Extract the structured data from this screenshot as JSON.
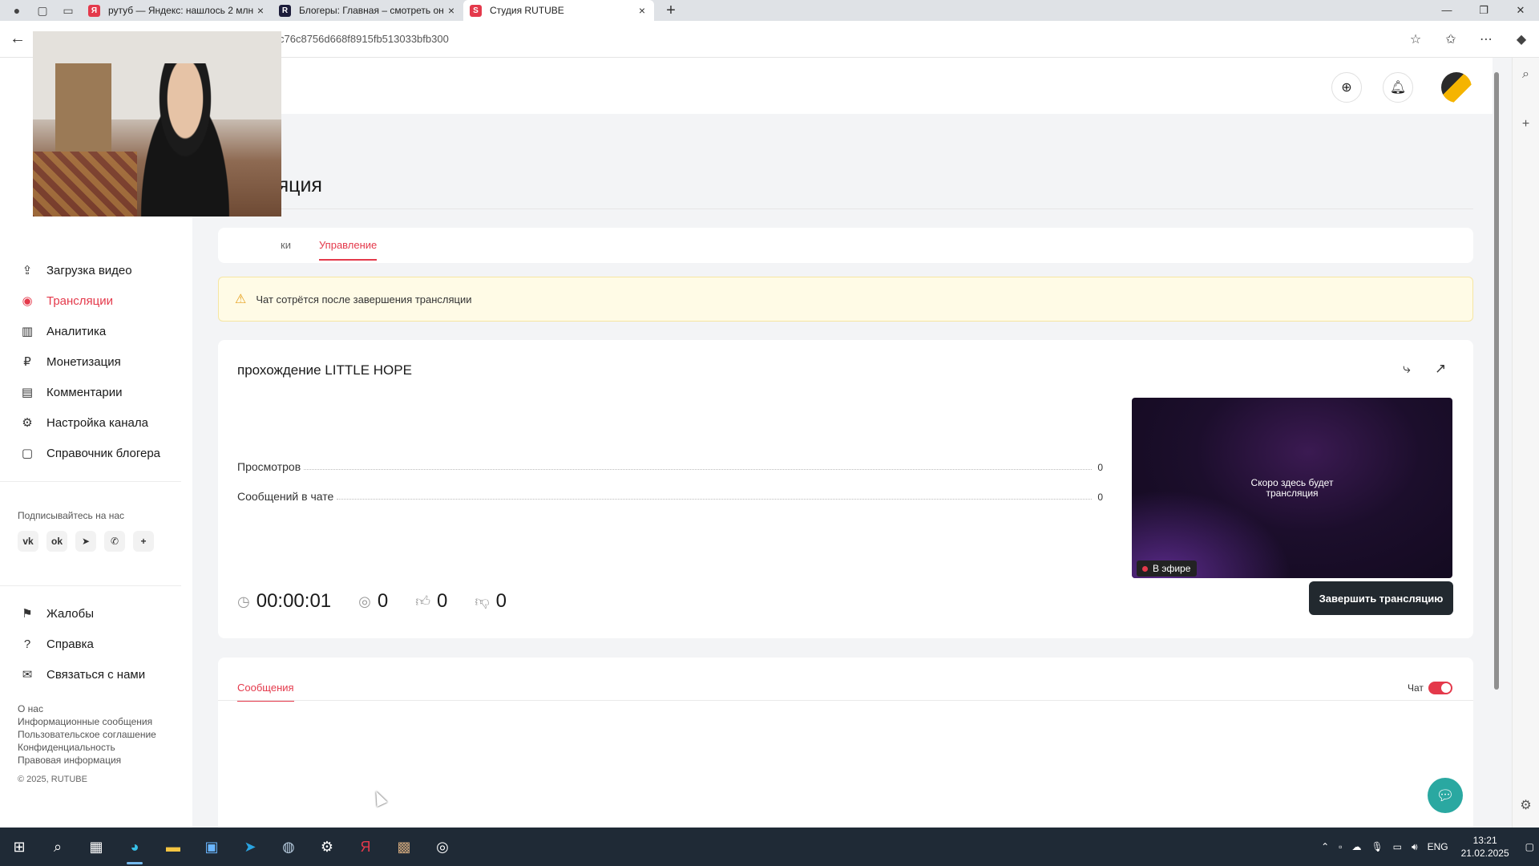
{
  "browser": {
    "tabs": [
      {
        "title": "рутуб — Яндекс: нашлось 2 млн",
        "fav_color": "#e4394b",
        "fav_text": "Я"
      },
      {
        "title": "Блогеры: Главная – смотреть он",
        "fav_color": "#1c1c3a",
        "fav_text": "R"
      },
      {
        "title": "Студия RUTUBE",
        "fav_color": "#e4394b",
        "fav_text": "S"
      }
    ],
    "url": "c76c8756d668f8915fb513033bfb300"
  },
  "sidebar": {
    "items": [
      {
        "label": "Загрузка видео",
        "icon": "upload-icon"
      },
      {
        "label": "Трансляции",
        "icon": "broadcast-icon"
      },
      {
        "label": "Аналитика",
        "icon": "analytics-icon"
      },
      {
        "label": "Монетизация",
        "icon": "ruble-icon"
      },
      {
        "label": "Комментарии",
        "icon": "comment-icon"
      },
      {
        "label": "Настройка канала",
        "icon": "gear-icon"
      },
      {
        "label": "Справочник блогера",
        "icon": "book-icon"
      }
    ],
    "subscribe_label": "Подписывайтесь на нас",
    "bottom_items": [
      {
        "label": "Жалобы",
        "icon": "flag-icon"
      },
      {
        "label": "Справка",
        "icon": "help-icon"
      },
      {
        "label": "Связаться с нами",
        "icon": "mail-icon"
      }
    ],
    "footer_links": [
      "О нас",
      "Информационные сообщения",
      "Пользовательское соглашение",
      "Конфиденциальность",
      "Правовая информация"
    ],
    "copyright": "© 2025, RUTUBE"
  },
  "page": {
    "title_partial": "ляция",
    "tabs": [
      "ки",
      "Управление"
    ],
    "warning": "Чат сотрётся после завершения трансляции",
    "stream_title": "прохождение LITTLE HOPE",
    "stats": [
      {
        "label": "Просмотров",
        "value": "0"
      },
      {
        "label": "Сообщений в чате",
        "value": "0"
      }
    ],
    "timer": "00:00:01",
    "viewers": "0",
    "likes": "0",
    "dislikes": "0",
    "preview_text_1": "Скоро здесь будет",
    "preview_text_2": "трансляция",
    "live_badge": "В эфире",
    "end_button": "Завершить трансляцию",
    "chat_tab": "Сообщения",
    "chat_toggle_label": "Чат"
  },
  "taskbar": {
    "lang": "ENG",
    "time": "13:21",
    "date": "21.02.2025"
  },
  "colors": {
    "accent": "#e4394b",
    "dark_button": "#22292f",
    "warning_bg": "#fffbe6"
  }
}
